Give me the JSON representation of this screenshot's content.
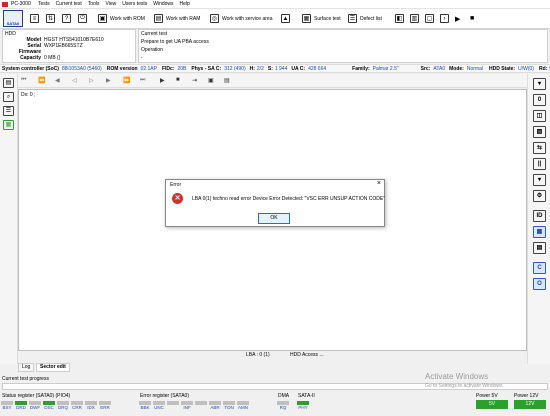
{
  "window": {
    "title": "PC-3000",
    "menu": [
      "Tests",
      "Current test",
      "Tools",
      "View",
      "Users tests",
      "Windows",
      "Help"
    ]
  },
  "toolbar": {
    "logo_label": "SATA0",
    "work_rom": "Work with ROM",
    "work_ram": "Work with RAM",
    "work_service": "Work with service area",
    "surface_test": "Surface test",
    "defect_list": "Defect list"
  },
  "hdd": {
    "header": "HDD",
    "fields": [
      {
        "key": "Model",
        "value": "HGST HTS541010B7E610"
      },
      {
        "key": "Serial",
        "value": "WXP1EB665STZ"
      },
      {
        "key": "Firmware",
        "value": ""
      },
      {
        "key": "Capacity",
        "value": "0 MB ()"
      }
    ]
  },
  "current_test": {
    "header": "Current test",
    "value": "Prepare to get UA PBA access",
    "operation_label": "Operation",
    "operation_value": "-"
  },
  "status": {
    "controller_label": "System controller (SoC)",
    "controller_value": "88i1053A0 (5460)",
    "rom_label": "ROM version",
    "rom_value": "02.1AP",
    "fidc_label": "FIDc:",
    "fidc_value": "20B",
    "phys_label": "Phys - SA C:",
    "phys_value": "312 (490)",
    "h_label": "H:",
    "h_value": "2/2",
    "s_label": "S:",
    "s_value": "1 944",
    "uac_label": "UA C:",
    "uac_value": "428 664",
    "family_label": "Family:",
    "family_value": "Palmar 2.5\"",
    "src_label": "Src:",
    "src_value": "ATA0",
    "mode_label": "Mode:",
    "mode_value": "Normal",
    "hddstate_label": "HDD State:",
    "hddstate_value": "U/W(0)",
    "rd_label": "Rd:",
    "rd_value": "0"
  },
  "editor": {
    "dx_label": "Dx: 0 ;",
    "lba_status": "LBA : 0 (1)",
    "hdd_access": "HDD Access ..."
  },
  "tabs": [
    "Log",
    "Sector edit"
  ],
  "progress": {
    "label": "Current test progress"
  },
  "registers": {
    "status_title": "Status register (SATA0) (PIO4)",
    "status_bits": [
      {
        "name": "BSY",
        "on": false
      },
      {
        "name": "DRD",
        "on": true
      },
      {
        "name": "DWF",
        "on": false
      },
      {
        "name": "DSC",
        "on": true
      },
      {
        "name": "DRQ",
        "on": false
      },
      {
        "name": "CRR",
        "on": false
      },
      {
        "name": "IDX",
        "on": false
      },
      {
        "name": "ERR",
        "on": false
      }
    ],
    "error_title": "Error register (SATA0)",
    "error_bits": [
      {
        "name": "BBK",
        "on": false
      },
      {
        "name": "UNC",
        "on": false
      },
      {
        "name": "",
        "on": false
      },
      {
        "name": "INF",
        "on": false
      },
      {
        "name": "",
        "on": false
      },
      {
        "name": "ABR",
        "on": false
      },
      {
        "name": "TON",
        "on": false
      },
      {
        "name": "AMN",
        "on": false
      }
    ],
    "dma_title": "DMA",
    "dma_bits": [
      {
        "name": "RQ",
        "on": false
      }
    ],
    "sata_title": "SATA-II",
    "sata_bits": [
      {
        "name": "PHY",
        "on": true
      }
    ],
    "power5_title": "Power 5V",
    "power5_value": "5V",
    "power12_title": "Power 12V",
    "power12_value": "12V"
  },
  "watermark": {
    "line1": "Activate Windows",
    "line2": "Go to Settings to activate Windows."
  },
  "dialog": {
    "title": "Error",
    "message": "LBA 0(1) techno read error Device Error Detected: \"VSC ERR UNSUP ACTION CODE\"",
    "ok": "OK"
  },
  "colors": {
    "accent": "#1e4bb0",
    "lamp_on": "#2ca02c",
    "error_icon": "#d32f2f"
  }
}
